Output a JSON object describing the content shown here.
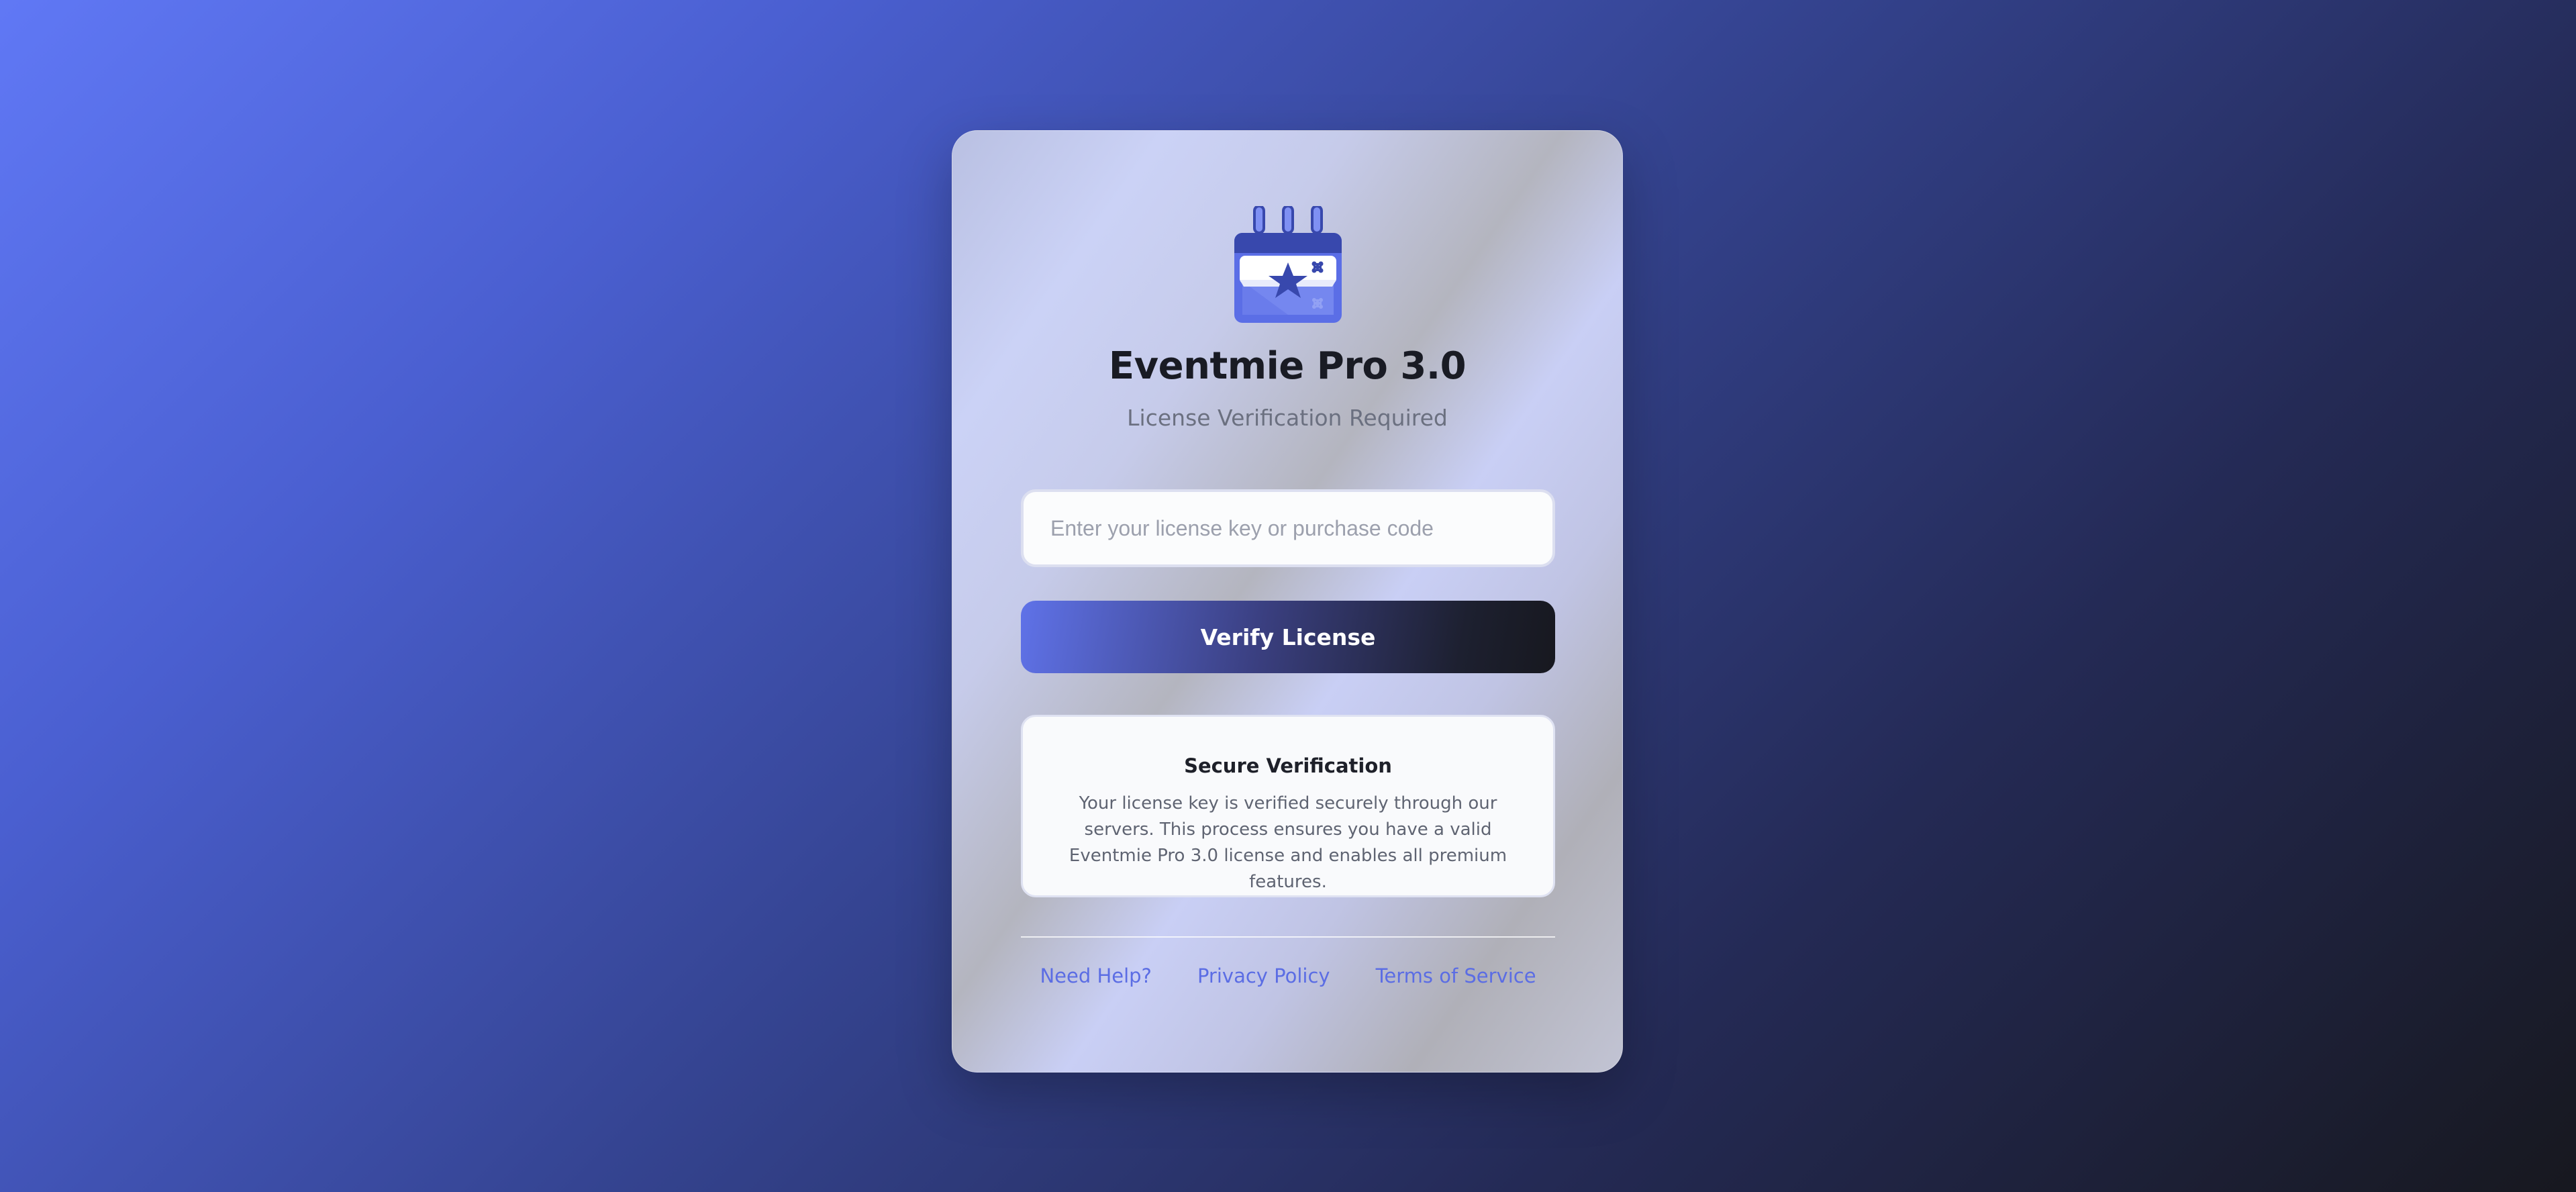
{
  "app": {
    "title": "Eventmie Pro 3.0",
    "subtitle": "License Verification Required"
  },
  "logo": {
    "icon": "calendar-star-icon"
  },
  "form": {
    "license_value": "",
    "license_placeholder": "Enter your license key or purchase code",
    "verify_label": "Verify License"
  },
  "info": {
    "title": "Secure Verification",
    "text": "Your license key is verified securely through our servers. This process ensures you have a valid Eventmie Pro 3.0 license and enables all premium features."
  },
  "footer": {
    "links": [
      {
        "label": "Need Help?"
      },
      {
        "label": "Privacy Policy"
      },
      {
        "label": "Terms of Service"
      }
    ]
  },
  "colors": {
    "accent": "#5b6de4",
    "text_dark": "#191b24",
    "text_muted": "#6b7080"
  }
}
